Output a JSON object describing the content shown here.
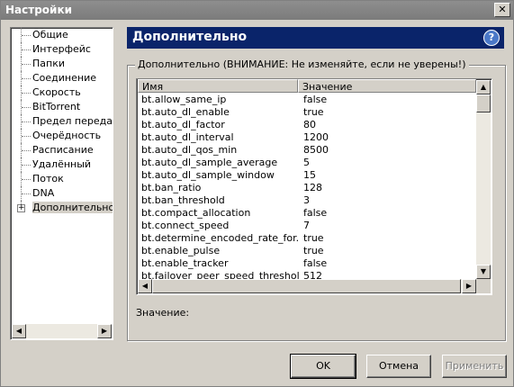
{
  "window": {
    "title": "Настройки",
    "close_label": "✕"
  },
  "sidebar": {
    "items": [
      {
        "label": "Общие"
      },
      {
        "label": "Интерфейс"
      },
      {
        "label": "Папки"
      },
      {
        "label": "Соединение"
      },
      {
        "label": "Скорость"
      },
      {
        "label": "BitTorrent"
      },
      {
        "label": "Предел передачи"
      },
      {
        "label": "Очерёдность"
      },
      {
        "label": "Расписание"
      },
      {
        "label": "Удалённый"
      },
      {
        "label": "Поток"
      },
      {
        "label": "DNA"
      },
      {
        "label": "Дополнительно",
        "selected": true,
        "expander": "+"
      }
    ]
  },
  "main": {
    "header": "Дополнительно",
    "help_icon": "?",
    "group_title": "Дополнительно (ВНИМАНИЕ: Не изменяйте, если не уверены!)",
    "table": {
      "columns": [
        "Имя",
        "Значение"
      ],
      "rows": [
        [
          "bt.allow_same_ip",
          "false"
        ],
        [
          "bt.auto_dl_enable",
          "true"
        ],
        [
          "bt.auto_dl_factor",
          "80"
        ],
        [
          "bt.auto_dl_interval",
          "1200"
        ],
        [
          "bt.auto_dl_qos_min",
          "8500"
        ],
        [
          "bt.auto_dl_sample_average",
          "5"
        ],
        [
          "bt.auto_dl_sample_window",
          "15"
        ],
        [
          "bt.ban_ratio",
          "128"
        ],
        [
          "bt.ban_threshold",
          "3"
        ],
        [
          "bt.compact_allocation",
          "false"
        ],
        [
          "bt.connect_speed",
          "7"
        ],
        [
          "bt.determine_encoded_rate_for...",
          "true"
        ],
        [
          "bt.enable_pulse",
          "true"
        ],
        [
          "bt.enable_tracker",
          "false"
        ],
        [
          "bt.failover_peer_speed_threshold",
          "512"
        ]
      ]
    },
    "value_label": "Значение:"
  },
  "footer": {
    "ok": "OK",
    "cancel": "Отмена",
    "apply": "Применить"
  },
  "icons": {
    "up": "▲",
    "down": "▼",
    "left": "◀",
    "right": "▶"
  }
}
